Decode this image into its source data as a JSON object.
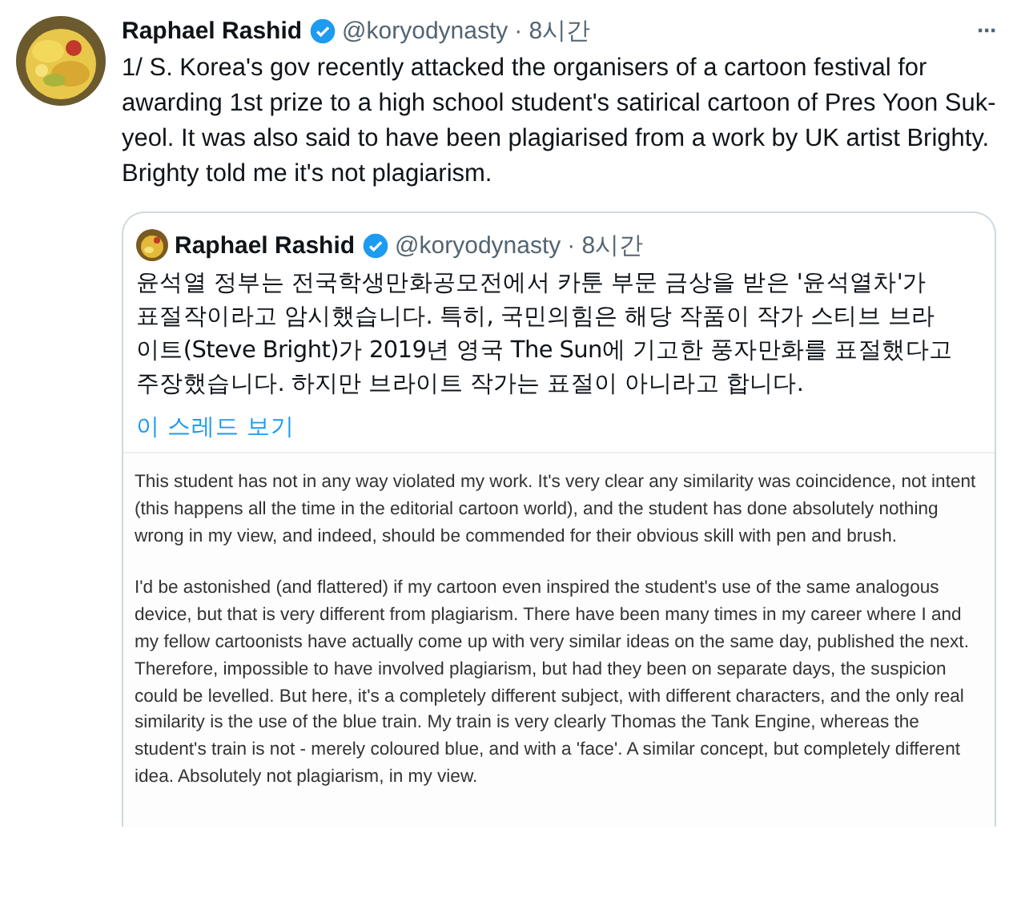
{
  "tweet": {
    "name": "Raphael Rashid",
    "verified": true,
    "handle": "@koryodynasty",
    "time": "· 8시간",
    "menu": "···",
    "text": "1/ S. Korea's gov recently attacked the organisers of a cartoon festival for awarding 1st prize to a high school student's satirical cartoon of Pres Yoon Suk-yeol. It was also said to have been plagiarised from a work by UK artist Brighty. Brighty told me it's not plagiarism."
  },
  "quote": {
    "name": "Raphael Rashid",
    "verified": true,
    "handle": "@koryodynasty",
    "time": "· 8시간",
    "text": "윤석열 정부는 전국학생만화공모전에서 카툰 부문 금상을 받은 '윤석열차'가 표절작이라고 암시했습니다. 특히, 국민의힘은 해당 작품이 작가 스티브 브라이트(Steve Bright)가 2019년 영국 The Sun에 기고한 풍자만화를 표절했다고 주장했습니다. 하지만 브라이트 작가는 표절이 아니라고 합니다.",
    "thread_link": "이 스레드 보기",
    "statement": [
      "This student has not in any way violated my work. It's very clear any similarity was coincidence, not intent (this happens all the time in the editorial cartoon world), and the student has done absolutely nothing wrong in my view, and indeed, should be commended for their obvious skill with pen and brush.",
      "I'd be astonished (and flattered) if my cartoon even inspired the student's use of the same analogous device, but that is very different from plagiarism. There have been many times in my career where I and my fellow cartoonists have actually come up with very similar ideas on the same day, published the next. Therefore, impossible to have involved plagiarism, but had they been on separate days, the suspicion could be levelled.  But here, it's a completely different subject, with different characters, and the only real similarity is the use of the blue train. My train is very clearly Thomas the Tank Engine, whereas the student's train is not - merely coloured blue, and with a 'face'. A similar concept, but completely different idea. Absolutely not plagiarism, in my view."
    ]
  }
}
